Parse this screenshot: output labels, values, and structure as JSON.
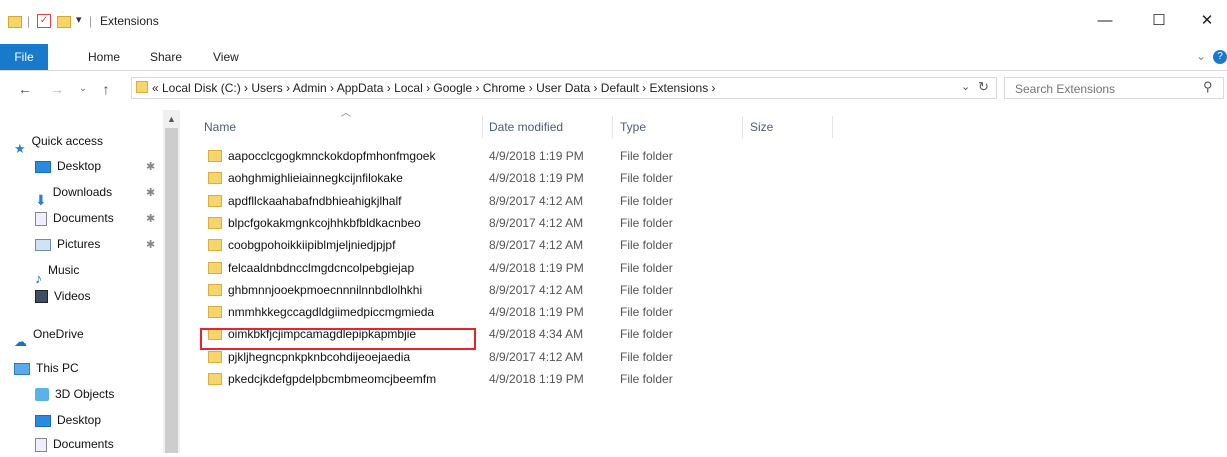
{
  "window": {
    "title": "Extensions",
    "controls": {
      "minimize": "—",
      "maximize": "☐",
      "close": "✕"
    }
  },
  "ribbon": {
    "tabs": [
      "File",
      "Home",
      "Share",
      "View"
    ]
  },
  "address_bar": {
    "path_text": "« Local Disk (C:)  ›  Users  ›  Admin  ›  AppData  ›  Local  ›  Google  ›  Chrome  ›  User Data  ›  Default  ›  Extensions  ›"
  },
  "search": {
    "placeholder": "Search Extensions"
  },
  "nav_pane": {
    "items": [
      {
        "label": "Quick access",
        "icon": "star-icon"
      },
      {
        "label": "Desktop",
        "icon": "desktop-icon",
        "pinned": true
      },
      {
        "label": "Downloads",
        "icon": "download-icon",
        "pinned": true
      },
      {
        "label": "Documents",
        "icon": "documents-icon",
        "pinned": true
      },
      {
        "label": "Pictures",
        "icon": "pictures-icon",
        "pinned": true
      },
      {
        "label": "Music",
        "icon": "music-icon"
      },
      {
        "label": "Videos",
        "icon": "videos-icon"
      },
      {
        "label": "OneDrive",
        "icon": "cloud-icon"
      },
      {
        "label": "This PC",
        "icon": "computer-icon"
      },
      {
        "label": "3D Objects",
        "icon": "cube-icon"
      },
      {
        "label": "Desktop",
        "icon": "desktop-icon"
      },
      {
        "label": "Documents",
        "icon": "documents-icon"
      }
    ]
  },
  "columns": {
    "name": "Name",
    "date": "Date modified",
    "type": "Type",
    "size": "Size"
  },
  "files": [
    {
      "name": "aapocclcgogkmnckokdopfmhonfmgoek",
      "date": "4/9/2018 1:19 PM",
      "type": "File folder"
    },
    {
      "name": "aohghmighlieiainnegkcijnfilokake",
      "date": "4/9/2018 1:19 PM",
      "type": "File folder"
    },
    {
      "name": "apdfllckaahabafndbhieahigkjlhalf",
      "date": "8/9/2017 4:12 AM",
      "type": "File folder"
    },
    {
      "name": "blpcfgokakmgnkcojhhkbfbldkacnbeo",
      "date": "8/9/2017 4:12 AM",
      "type": "File folder"
    },
    {
      "name": "coobgpohoikkiipiblmjeljniedjpjpf",
      "date": "8/9/2017 4:12 AM",
      "type": "File folder"
    },
    {
      "name": "felcaaldnbdncclmgdcncolpebgiejap",
      "date": "4/9/2018 1:19 PM",
      "type": "File folder"
    },
    {
      "name": "ghbmnnjooekpmoecnnnilnnbdlolhkhi",
      "date": "8/9/2017 4:12 AM",
      "type": "File folder"
    },
    {
      "name": "nmmhkkegccagdldgiimedpiccmgmieda",
      "date": "4/9/2018 1:19 PM",
      "type": "File folder"
    },
    {
      "name": "oimkbkfjcjimpcamagdlepipkapmbjie",
      "date": "4/9/2018 4:34 AM",
      "type": "File folder",
      "highlighted": true
    },
    {
      "name": "pjkljhegncpnkpknbcohdijeoejaedia",
      "date": "8/9/2017 4:12 AM",
      "type": "File folder"
    },
    {
      "name": "pkedcjkdefgpdelpbcmbmeomcjbeemfm",
      "date": "4/9/2018 1:19 PM",
      "type": "File folder"
    }
  ],
  "colors": {
    "accent": "#1979ca",
    "highlight": "#e8232c",
    "folder": "#f7d56d"
  }
}
